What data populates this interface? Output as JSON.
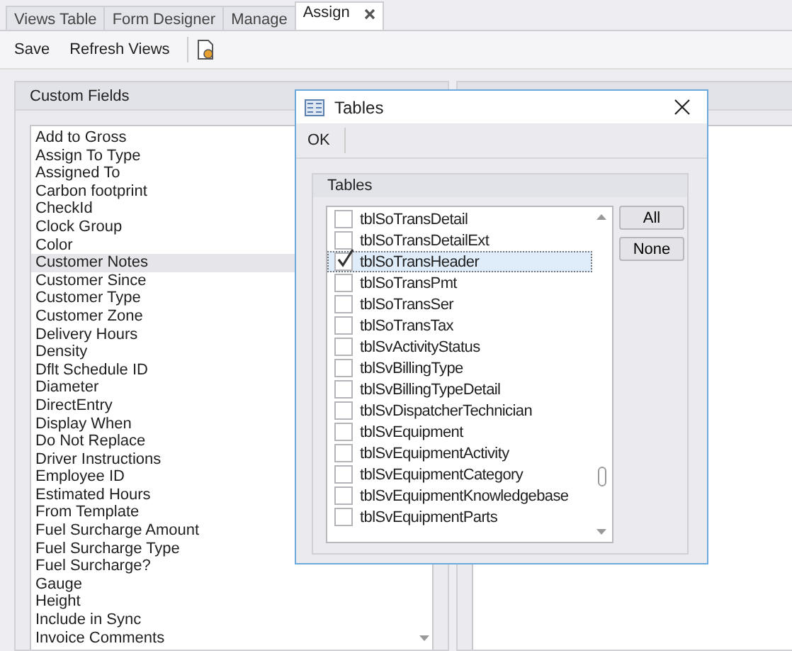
{
  "tabs": [
    {
      "label": "Views Table",
      "selected": false,
      "closable": false
    },
    {
      "label": "Form Designer",
      "selected": false,
      "closable": false
    },
    {
      "label": "Manage",
      "selected": false,
      "closable": false
    },
    {
      "label": "Assign",
      "selected": true,
      "closable": true
    }
  ],
  "toolbar": {
    "buttons": [
      "Save",
      "Refresh Views"
    ]
  },
  "custom_fields": {
    "title": "Custom Fields",
    "items": [
      {
        "label": "Add to Gross",
        "selected": false
      },
      {
        "label": "Assign To Type",
        "selected": false
      },
      {
        "label": "Assigned To",
        "selected": false
      },
      {
        "label": "Carbon footprint",
        "selected": false
      },
      {
        "label": "CheckId",
        "selected": false
      },
      {
        "label": "Clock Group",
        "selected": false
      },
      {
        "label": "Color",
        "selected": false
      },
      {
        "label": "Customer Notes",
        "selected": true
      },
      {
        "label": "Customer Since",
        "selected": false
      },
      {
        "label": "Customer Type",
        "selected": false
      },
      {
        "label": "Customer Zone",
        "selected": false
      },
      {
        "label": "Delivery Hours",
        "selected": false
      },
      {
        "label": "Density",
        "selected": false
      },
      {
        "label": "Dflt Schedule ID",
        "selected": false
      },
      {
        "label": "Diameter",
        "selected": false
      },
      {
        "label": "DirectEntry",
        "selected": false
      },
      {
        "label": "Display When",
        "selected": false
      },
      {
        "label": "Do Not Replace",
        "selected": false
      },
      {
        "label": "Driver Instructions",
        "selected": false
      },
      {
        "label": "Employee ID",
        "selected": false
      },
      {
        "label": "Estimated Hours",
        "selected": false
      },
      {
        "label": "From Template",
        "selected": false
      },
      {
        "label": "Fuel Surcharge Amount",
        "selected": false
      },
      {
        "label": "Fuel Surcharge Type",
        "selected": false
      },
      {
        "label": "Fuel Surcharge?",
        "selected": false
      },
      {
        "label": "Gauge",
        "selected": false
      },
      {
        "label": "Height",
        "selected": false
      },
      {
        "label": "Include in Sync",
        "selected": false
      },
      {
        "label": "Invoice Comments",
        "selected": false
      }
    ]
  },
  "dialog": {
    "title": "Tables",
    "ok": "OK",
    "group_title": "Tables",
    "buttons": [
      "All",
      "None"
    ],
    "items": [
      {
        "label": "tblSoTransDetail",
        "checked": false,
        "selected": false
      },
      {
        "label": "tblSoTransDetailExt",
        "checked": false,
        "selected": false
      },
      {
        "label": "tblSoTransHeader",
        "checked": true,
        "selected": true
      },
      {
        "label": "tblSoTransPmt",
        "checked": false,
        "selected": false
      },
      {
        "label": "tblSoTransSer",
        "checked": false,
        "selected": false
      },
      {
        "label": "tblSoTransTax",
        "checked": false,
        "selected": false
      },
      {
        "label": "tblSvActivityStatus",
        "checked": false,
        "selected": false
      },
      {
        "label": "tblSvBillingType",
        "checked": false,
        "selected": false
      },
      {
        "label": "tblSvBillingTypeDetail",
        "checked": false,
        "selected": false
      },
      {
        "label": "tblSvDispatcherTechnician",
        "checked": false,
        "selected": false
      },
      {
        "label": "tblSvEquipment",
        "checked": false,
        "selected": false
      },
      {
        "label": "tblSvEquipmentActivity",
        "checked": false,
        "selected": false
      },
      {
        "label": "tblSvEquipmentCategory",
        "checked": false,
        "selected": false
      },
      {
        "label": "tblSvEquipmentKnowledgebase",
        "checked": false,
        "selected": false
      },
      {
        "label": "tblSvEquipmentParts",
        "checked": false,
        "selected": false
      }
    ]
  }
}
